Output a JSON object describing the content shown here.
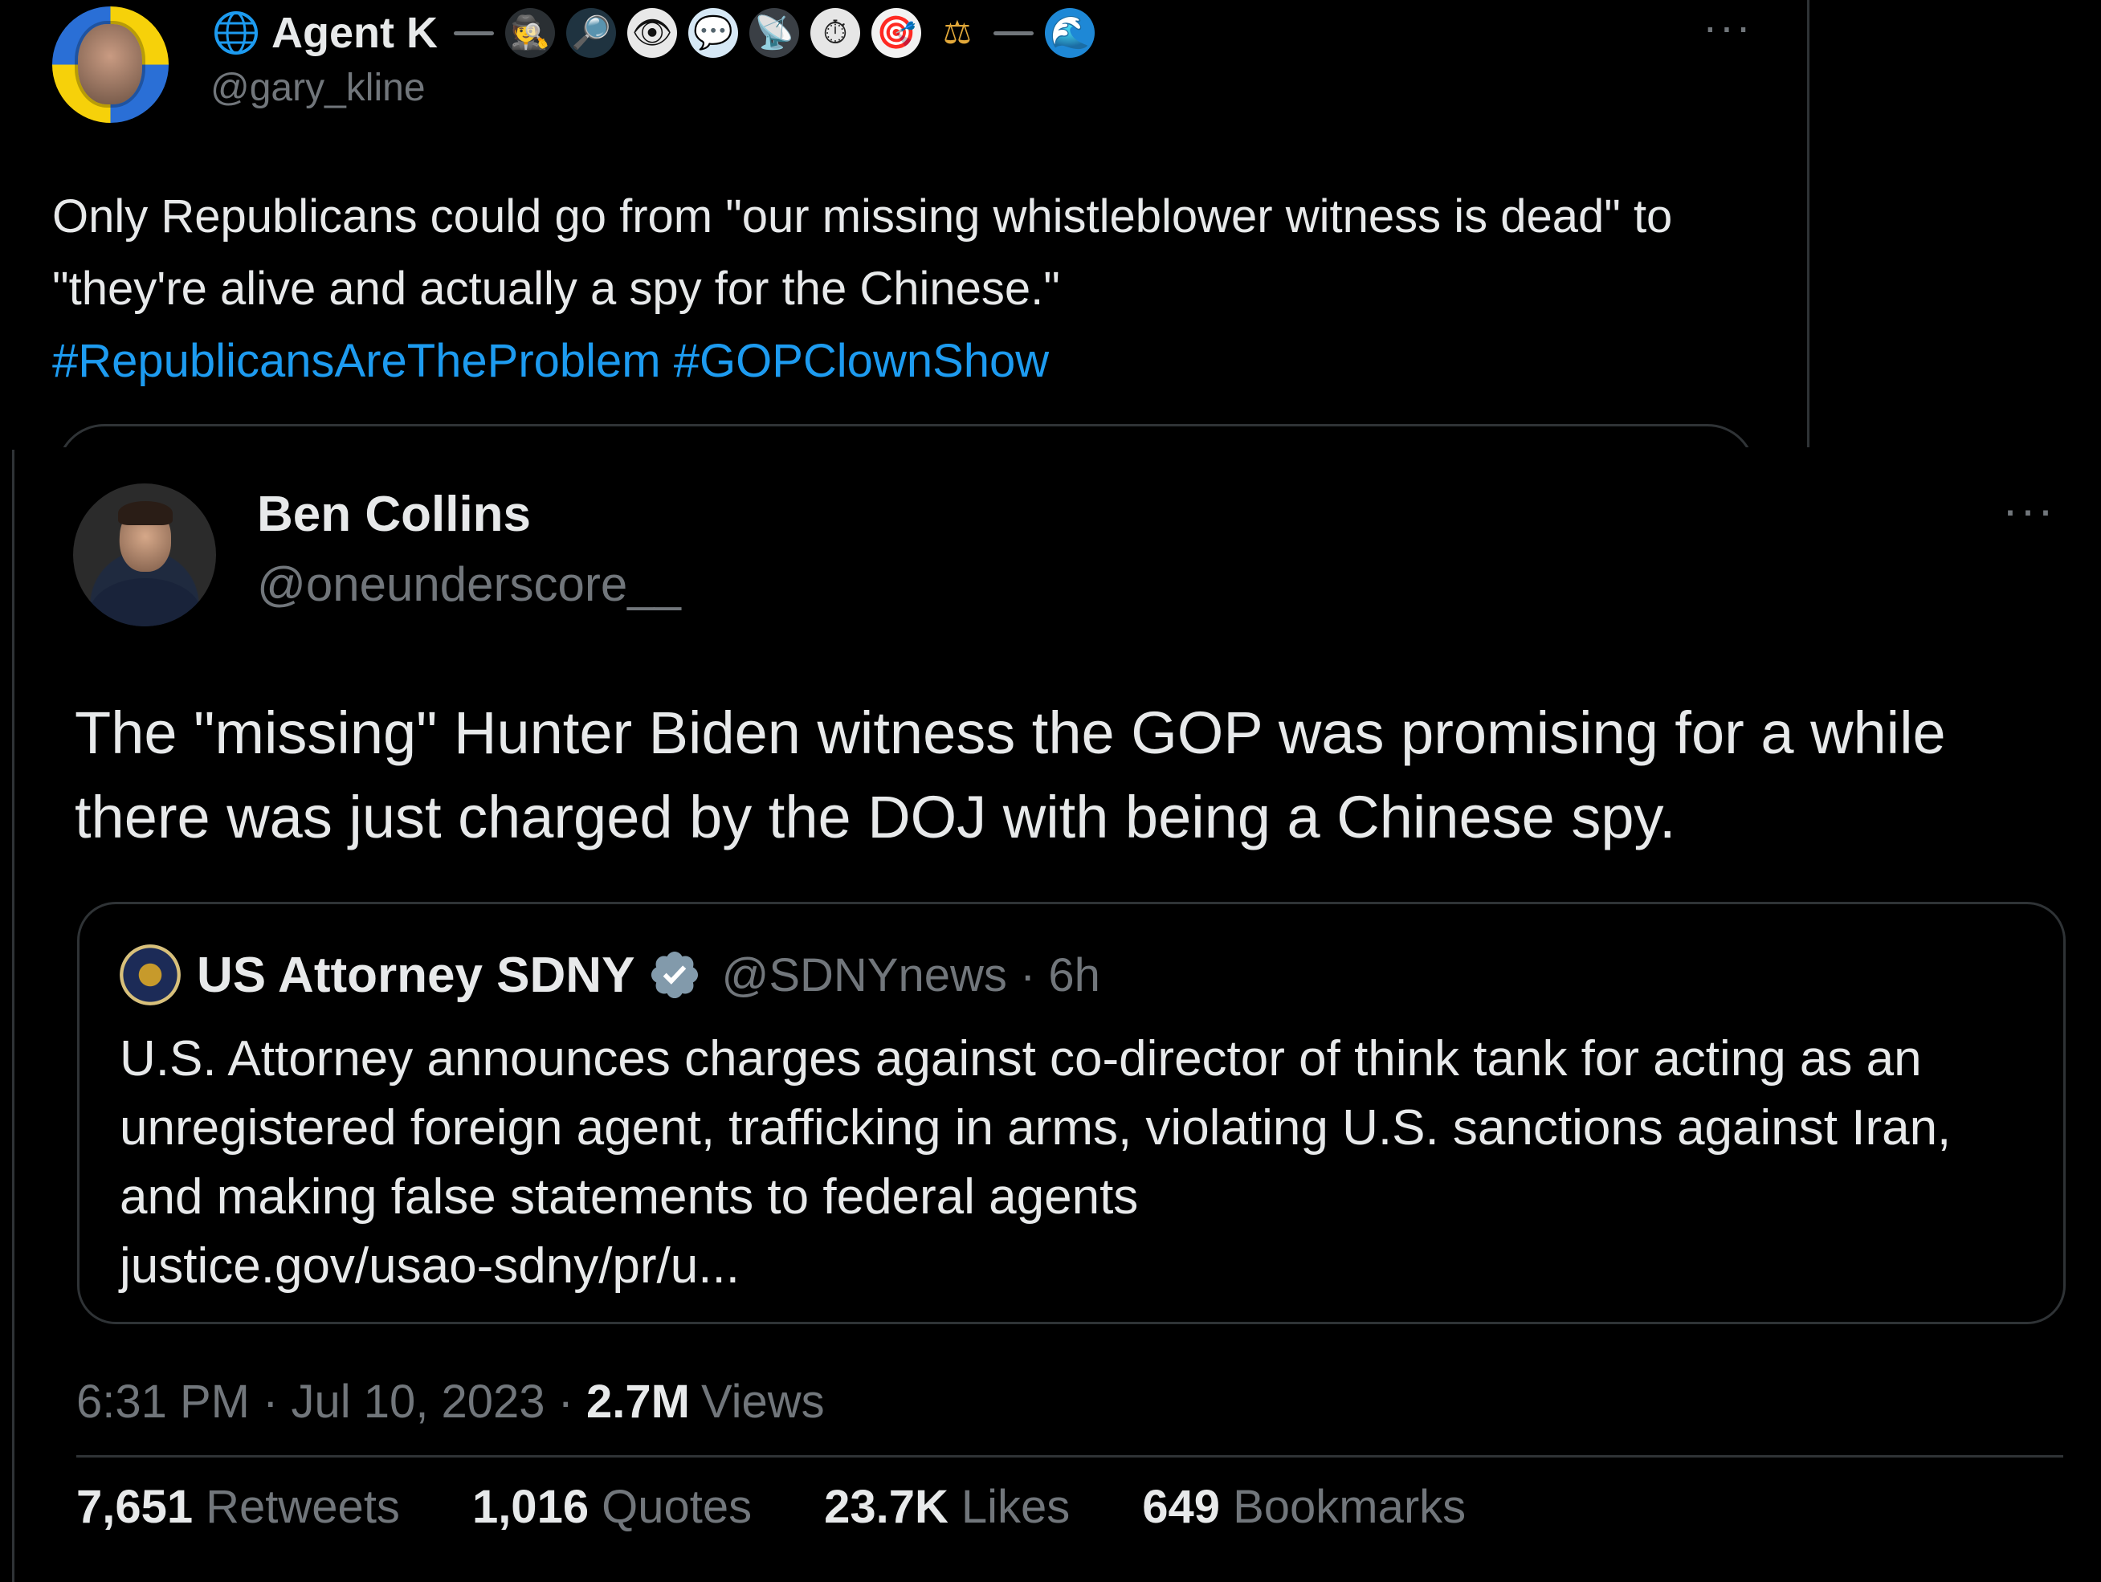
{
  "top_tweet": {
    "display_name": "Agent K",
    "handle": "@gary_kline",
    "name_emojis": [
      "🕵",
      "🔎",
      "👁",
      "💬",
      "📡",
      "⏱",
      "🎯",
      "⚖",
      "🌊"
    ],
    "text": "Only Republicans could go from \"our missing whistleblower witness is dead\" to \"they're alive and actually a spy for the Chinese.\"",
    "hashtags": "#RepublicansAreTheProblem #GOPClownShow",
    "more": "···"
  },
  "main_tweet": {
    "display_name": "Ben Collins",
    "handle": "@oneunderscore__",
    "more": "···",
    "text": "The \"missing\" Hunter Biden witness the GOP was promising for a while there was just charged by the DOJ with being a Chinese spy.",
    "quoted": {
      "display_name": "US Attorney SDNY",
      "handle_time": "@SDNYnews · 6h",
      "text": "U.S. Attorney announces charges against co-director of think tank for acting as an unregistered foreign agent, trafficking in arms, violating U.S. sanctions against Iran, and making false statements to federal agents",
      "link": "justice.gov/usao-sdny/pr/u..."
    },
    "timestamp": "6:31 PM · Jul 10, 2023 ·",
    "views_count": "2.7M",
    "views_label": "Views",
    "stats": {
      "retweets_count": "7,651",
      "retweets_label": "Retweets",
      "quotes_count": "1,016",
      "quotes_label": "Quotes",
      "likes_count": "23.7K",
      "likes_label": "Likes",
      "bookmarks_count": "649",
      "bookmarks_label": "Bookmarks"
    }
  },
  "colors": {
    "background": "#000000",
    "text_primary": "#e7e9ea",
    "text_secondary": "#71767b",
    "link": "#1d9bf0",
    "border": "#2f3336",
    "verified": "#829aab"
  }
}
